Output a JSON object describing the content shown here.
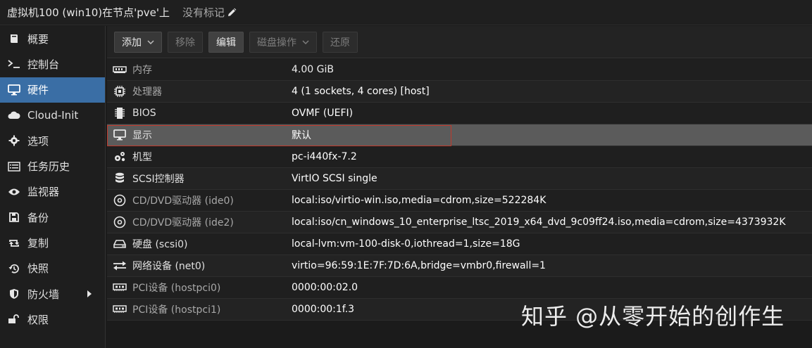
{
  "titlebar": {
    "title": "虚拟机100 (win10)在节点'pve'上",
    "tags_label": "没有标记"
  },
  "sidebar": {
    "items": [
      {
        "label": "概要",
        "icon": "book-icon"
      },
      {
        "label": "控制台",
        "icon": "terminal-icon"
      },
      {
        "label": "硬件",
        "icon": "desktop-icon",
        "active": true
      },
      {
        "label": "Cloud-Init",
        "icon": "cloud-icon"
      },
      {
        "label": "选项",
        "icon": "gear-icon"
      },
      {
        "label": "任务历史",
        "icon": "list-icon"
      },
      {
        "label": "监视器",
        "icon": "eye-icon"
      },
      {
        "label": "备份",
        "icon": "save-icon"
      },
      {
        "label": "复制",
        "icon": "retweet-icon"
      },
      {
        "label": "快照",
        "icon": "history-icon"
      },
      {
        "label": "防火墙",
        "icon": "shield-icon",
        "has_submenu": true
      },
      {
        "label": "权限",
        "icon": "unlock-icon"
      }
    ]
  },
  "toolbar": {
    "add_label": "添加",
    "remove_label": "移除",
    "edit_label": "编辑",
    "disk_action_label": "磁盘操作",
    "revert_label": "还原"
  },
  "hardware": {
    "rows": [
      {
        "icon": "memory-icon",
        "name": "内存",
        "value": "4.00 GiB",
        "dim": true
      },
      {
        "icon": "cpu-icon",
        "name": "处理器",
        "value": "4 (1 sockets, 4 cores) [host]",
        "dim": true
      },
      {
        "icon": "microchip-icon",
        "name": "BIOS",
        "value": "OVMF (UEFI)"
      },
      {
        "icon": "desktop-icon",
        "name": "显示",
        "value": "默认",
        "selected": true
      },
      {
        "icon": "cogs-icon",
        "name": "机型",
        "value": "pc-i440fx-7.2"
      },
      {
        "icon": "database-icon",
        "name": "SCSI控制器",
        "value": "VirtIO SCSI single"
      },
      {
        "icon": "cdrom-icon",
        "name": "CD/DVD驱动器 (ide0)",
        "value": "local:iso/virtio-win.iso,media=cdrom,size=522284K",
        "dim": true
      },
      {
        "icon": "cdrom-icon",
        "name": "CD/DVD驱动器 (ide2)",
        "value": "local:iso/cn_windows_10_enterprise_ltsc_2019_x64_dvd_9c09ff24.iso,media=cdrom,size=4373932K",
        "dim": true
      },
      {
        "icon": "hdd-icon",
        "name": "硬盘 (scsi0)",
        "value": "local-lvm:vm-100-disk-0,iothread=1,size=18G"
      },
      {
        "icon": "exchange-icon",
        "name": "网络设备 (net0)",
        "value": "virtio=96:59:1E:7F:7D:6A,bridge=vmbr0,firewall=1"
      },
      {
        "icon": "pci-icon",
        "name": "PCI设备 (hostpci0)",
        "value": "0000:00:02.0",
        "dim": true
      },
      {
        "icon": "pci-icon",
        "name": "PCI设备 (hostpci1)",
        "value": "0000:00:1f.3",
        "dim": true
      }
    ]
  },
  "watermark": "知乎 @从零开始的创作生"
}
